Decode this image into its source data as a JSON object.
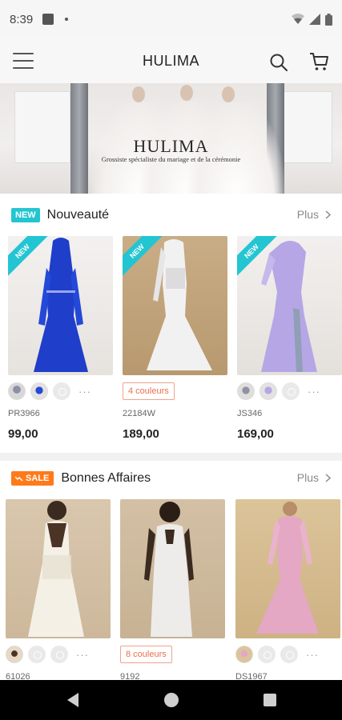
{
  "status_bar": {
    "time": "8:39"
  },
  "app_bar": {
    "title": "HULIMA"
  },
  "banner": {
    "brand": "HULIMA",
    "tagline": "Grossiste spécialiste du mariage et de la cérémonie"
  },
  "sections": {
    "new": {
      "badge": "NEW",
      "title": "Nouveauté",
      "more": "Plus",
      "products": [
        {
          "ribbon": "NEW",
          "sku": "PR3966",
          "price": "99,00"
        },
        {
          "ribbon": "NEW",
          "colors": "4 couleurs",
          "sku": "22184W",
          "price": "189,00"
        },
        {
          "ribbon": "NEW",
          "sku": "JS346",
          "price": "169,00"
        }
      ]
    },
    "sale": {
      "badge": "SALE",
      "title": "Bonnes Affaires",
      "more": "Plus",
      "products": [
        {
          "sku": "61026"
        },
        {
          "colors": "8 couleurs",
          "sku": "9192"
        },
        {
          "sku": "DS1967"
        }
      ]
    }
  },
  "colors": {
    "new_badge": "#24c5d2",
    "sale_badge": "#ff7a1a",
    "colors_pill": "#e8704d"
  },
  "icons": [
    "menu-icon",
    "search-icon",
    "cart-icon",
    "chevron-right-icon",
    "trend-icon",
    "wifi-icon",
    "signal-icon",
    "battery-icon",
    "back-icon",
    "home-icon",
    "recent-apps-icon"
  ]
}
